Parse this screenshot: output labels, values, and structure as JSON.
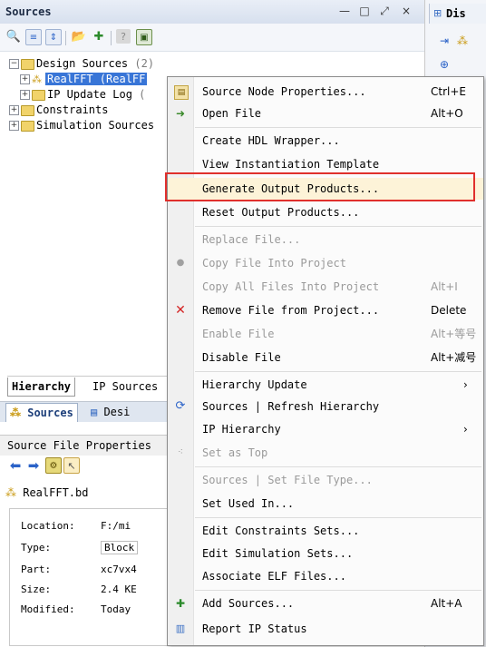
{
  "sources_panel": {
    "title": "Sources",
    "window_buttons": [
      "—",
      "□",
      "⤢",
      "×"
    ]
  },
  "tree": {
    "rows": [
      {
        "label": "Design Sources",
        "count": "(2)"
      },
      {
        "label": "RealFFT (RealFF"
      },
      {
        "label": "IP Update Log",
        "trail": "("
      },
      {
        "label": "Constraints"
      },
      {
        "label": "Simulation Sources"
      }
    ]
  },
  "hierarchy_tabs": [
    "Hierarchy",
    "IP Sources"
  ],
  "source_tabs": [
    "Sources",
    "Desi"
  ],
  "file_props": {
    "header": "Source File Properties",
    "filename": "RealFFT.bd",
    "rows": [
      {
        "key": "Location:",
        "value": "F:/mi"
      },
      {
        "key": "Type:",
        "value": "Block"
      },
      {
        "key": "Part:",
        "value": "xc7vx4"
      },
      {
        "key": "Size:",
        "value": "2.4 KE"
      },
      {
        "key": "Modified:",
        "value": "Today"
      }
    ]
  },
  "right_strip": {
    "tab_label": "Dis"
  },
  "context_menu": {
    "items": [
      {
        "label": "Source Node Properties...",
        "shortcut": "Ctrl+E",
        "icon": "properties-icon"
      },
      {
        "label": "Open File",
        "shortcut": "Alt+O",
        "icon": "open-file-icon"
      },
      {
        "label": "Create HDL Wrapper..."
      },
      {
        "label": "View Instantiation Template"
      },
      {
        "label": "Generate Output Products..."
      },
      {
        "label": "Reset Output Products..."
      },
      {
        "label": "Replace File..."
      },
      {
        "label": "Copy File Into Project",
        "icon": "dot-icon"
      },
      {
        "label": "Copy All Files Into Project",
        "shortcut": "Alt+I"
      },
      {
        "label": "Remove File from Project...",
        "shortcut": "Delete",
        "icon": "remove-icon"
      },
      {
        "label": "Enable File",
        "shortcut": "Alt+等号"
      },
      {
        "label": "Disable File",
        "shortcut": "Alt+减号"
      },
      {
        "label": "Hierarchy Update",
        "arrow": "›"
      },
      {
        "label": "Sources | Refresh Hierarchy",
        "icon": "refresh-icon"
      },
      {
        "label": "IP Hierarchy",
        "arrow": "›"
      },
      {
        "label": "Set as Top",
        "icon": "set-top-icon"
      },
      {
        "label": "Sources | Set File Type..."
      },
      {
        "label": "Set Used In..."
      },
      {
        "label": "Edit Constraints Sets..."
      },
      {
        "label": "Edit Simulation Sets..."
      },
      {
        "label": "Associate ELF Files..."
      },
      {
        "label": "Add Sources...",
        "shortcut": "Alt+A",
        "icon": "add-sources-icon"
      },
      {
        "label": "Report IP Status",
        "icon": "report-icon"
      }
    ]
  },
  "colors": {
    "highlight_border": "#e0302c",
    "selection": "#3875d7"
  }
}
